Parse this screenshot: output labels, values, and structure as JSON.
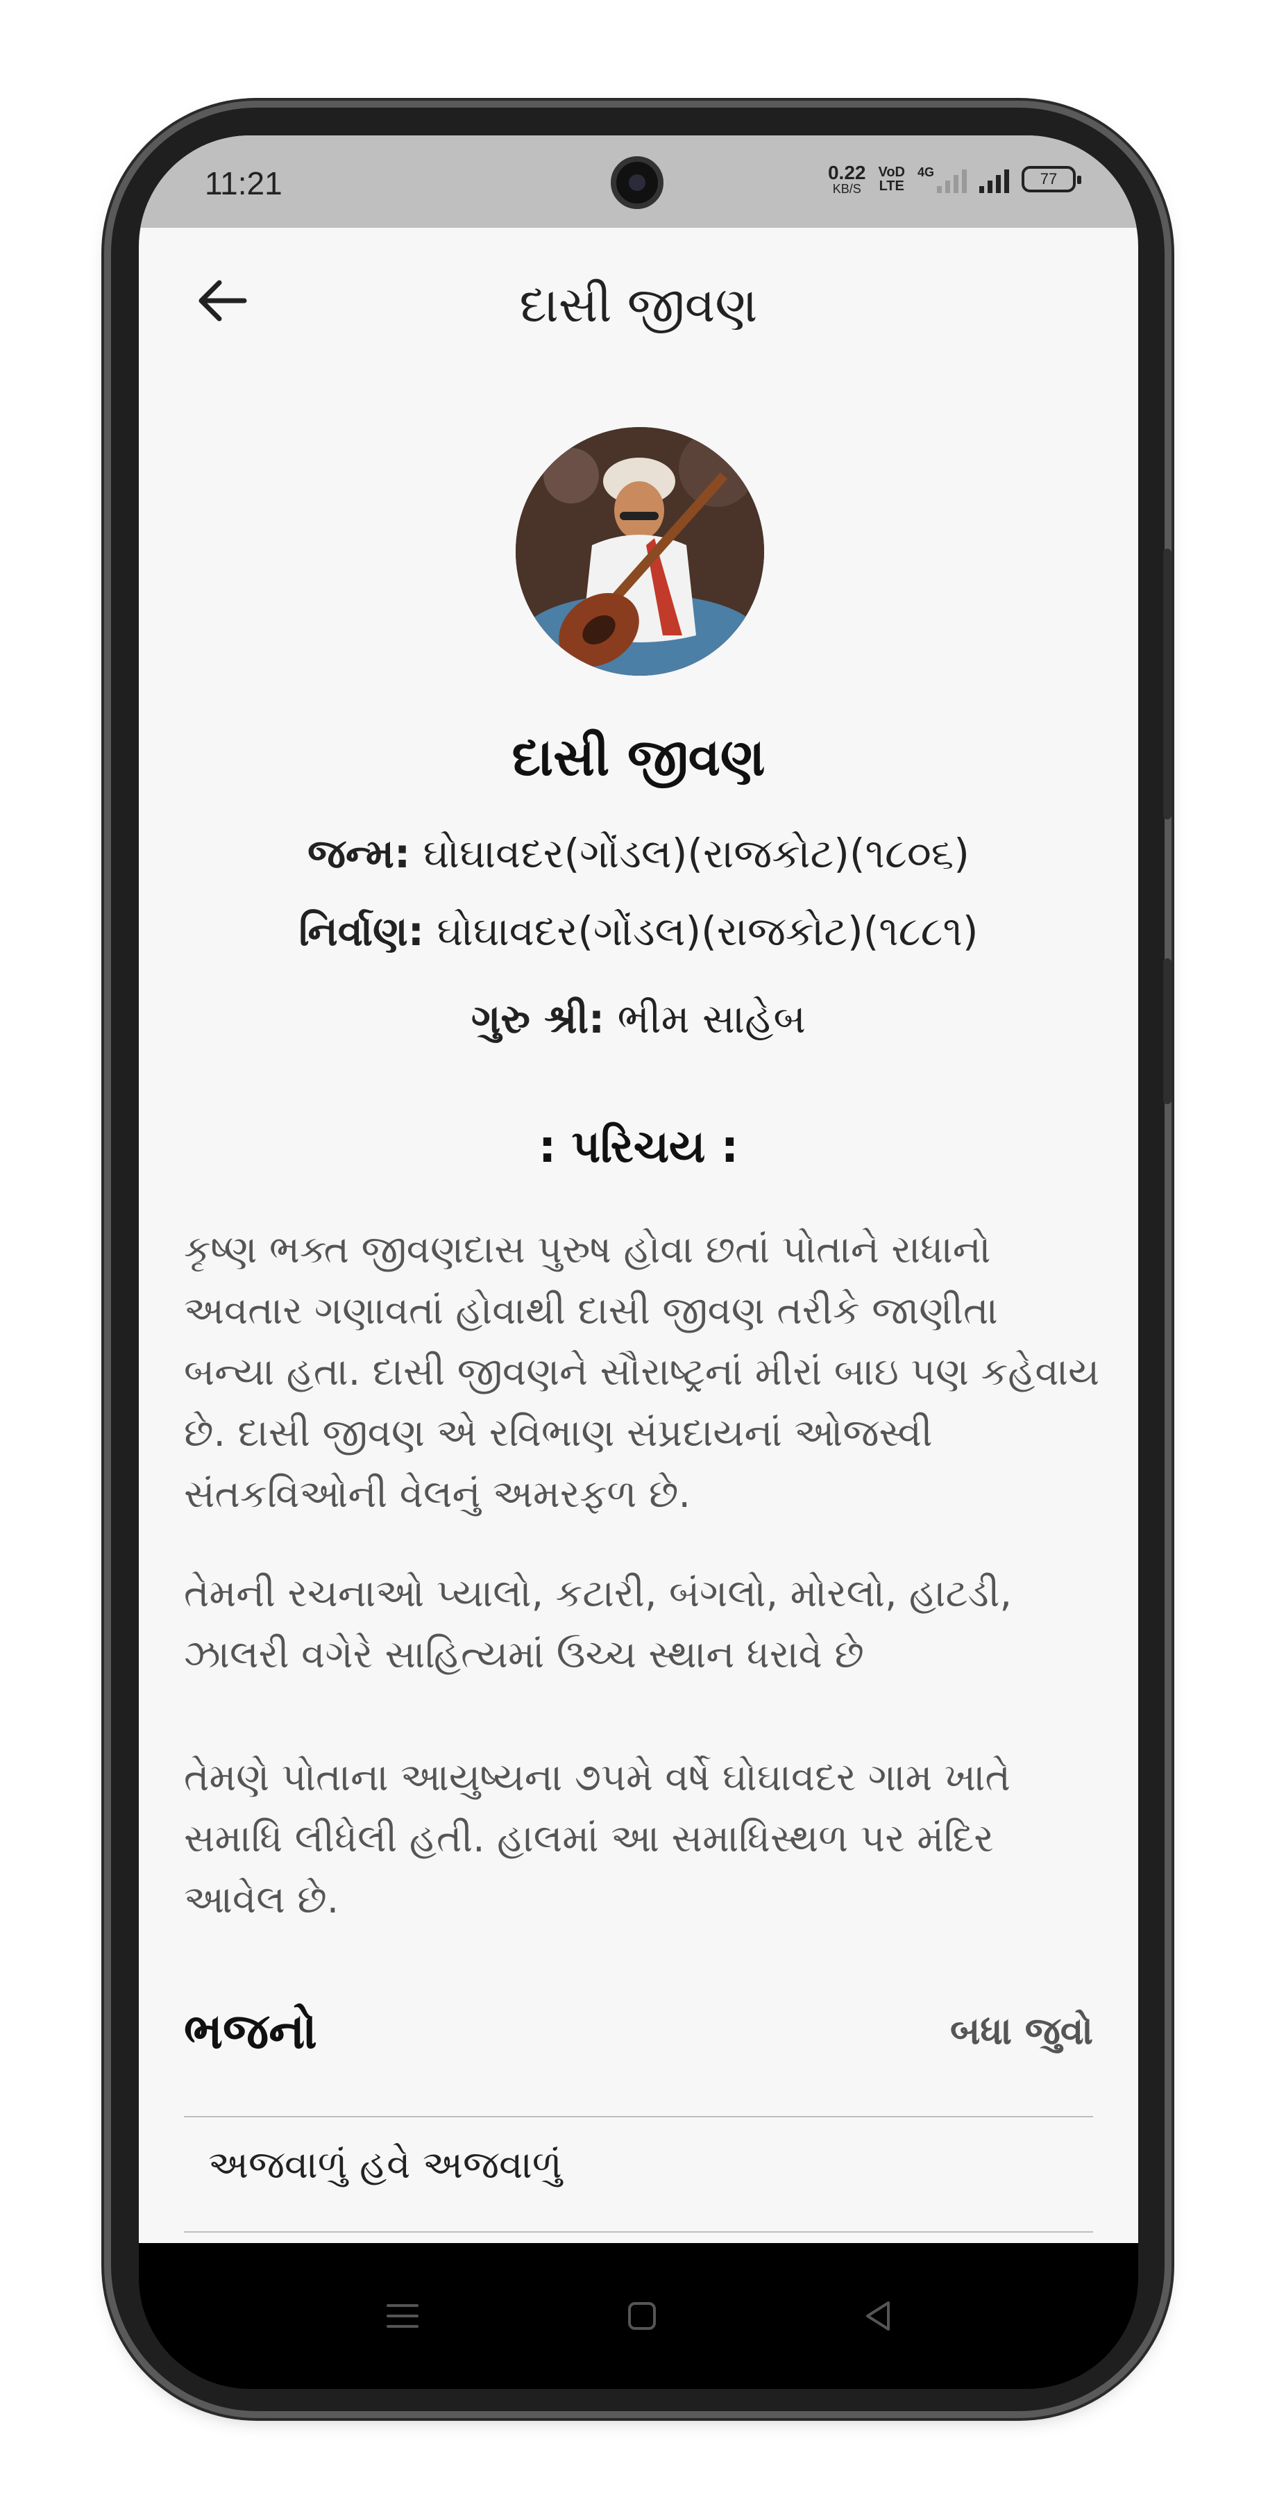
{
  "status": {
    "time": "11:21",
    "net_speed_value": "0.22",
    "net_speed_unit": "KB/S",
    "volte_top": "VoD",
    "volte_bottom": "LTE",
    "network_type": "4G",
    "battery": "77"
  },
  "appbar": {
    "title": "દાસી જીવણ"
  },
  "profile": {
    "name": "દાસી જીવણ",
    "birth_label": "જન્મ:",
    "birth_value": "ઘોઘાવદર(ગોંડલ)(રાજકોટ)(૧૮૦૬)",
    "nirvana_label": "નિર્વાણ:",
    "nirvana_value": "ઘોઘાવદર(ગોંડલ)(રાજકોટ)(૧૮૮૧)",
    "guru_label": "ગુરુ શ્રી:",
    "guru_value": "ભીમ સાહેબ"
  },
  "intro": {
    "title": ": પરિચય :",
    "paragraphs": [
      "કૃષ્ણ ભક્ત જીવણદાસ પુરુષ હોવા છતાં પોતાને રાધાનો અવતાર ગણાવતાં હોવાથી દાસી જીવણ તરીકે જાણીતા બન્યા હતા. દાસી જીવણને સૌરાષ્ટ્રનાં મીરાં બાઇ પણ કહેવાય છે. દાસી જીવણ એ રવિભાણ સંપ્રદાયનાં ઓજસ્વી સંતકવિઓની વેલનું અમરફળ છે.",
      "તેમની રચનાઓ પ્યાલો, કટારી, બંગલો, મોરલો, હાટડી, ઝાલરી વગેરે સાહિત્યમાં ઉચ્ચ સ્થાન ધરાવે છે",
      "તેમણે પોતાના આયુષ્યના ૭૫મે વર્ષે ઘોઘાવદર ગામ ખાતે સમાધિ લીધેલી હતી. હાલમાં આ સમાધિસ્થળ પર મંદિર આવેલ છે."
    ]
  },
  "bhajans": {
    "title": "ભજનો",
    "see_all": "બધા જુવો",
    "items": [
      "અજવાળું હવે અજવાળું"
    ]
  },
  "icons": {
    "back": "arrow-left-icon",
    "nav_menu": "menu-icon",
    "nav_home": "home-square-icon",
    "nav_back": "triangle-back-icon"
  }
}
